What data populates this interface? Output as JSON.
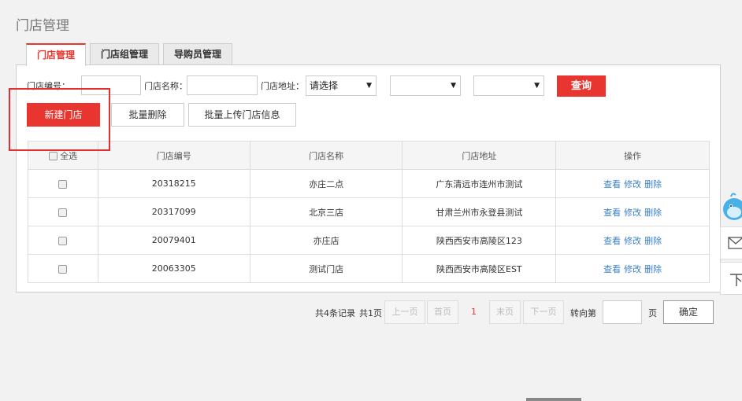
{
  "page": {
    "title": "门店管理"
  },
  "tabs": [
    {
      "label": "门店管理",
      "active": true
    },
    {
      "label": "门店组管理",
      "active": false
    },
    {
      "label": "导购员管理",
      "active": false
    }
  ],
  "filters": {
    "store_code_label": "门店编号：",
    "store_name_label": "门店名称：",
    "store_address_label": "门店地址：",
    "province_select": "请选择",
    "city_select": "",
    "district_select": "",
    "query_button": "查询"
  },
  "actions": {
    "new_store": "新建门店",
    "batch_delete": "批量删除",
    "batch_upload": "批量上传门店信息"
  },
  "table": {
    "columns": [
      "全选",
      "门店编号",
      "门店名称",
      "门店地址",
      "操作"
    ],
    "rows": [
      {
        "code": "20318215",
        "name": "亦庄二点",
        "address": "广东清远市连州市测试"
      },
      {
        "code": "20317099",
        "name": "北京三店",
        "address": "甘肃兰州市永登县测试"
      },
      {
        "code": "20079401",
        "name": "亦庄店",
        "address": "陕西西安市高陵区123"
      },
      {
        "code": "20063305",
        "name": "测试门店",
        "address": "陕西西安市高陵区EST"
      }
    ],
    "ops": {
      "view": "查看",
      "edit": "修改",
      "delete": "删除"
    }
  },
  "pager": {
    "total": "共4条记录",
    "pages": "共1页",
    "prev": "上一页",
    "first": "首页",
    "current": "1",
    "last": "末页",
    "next": "下一页",
    "goto": "转向第",
    "page_unit": "页",
    "confirm": "确定"
  },
  "colors": {
    "accent": "#e8352f",
    "link": "#3a7fc8"
  },
  "side_icons": [
    "mascot-icon",
    "mail-icon",
    "top-icon"
  ]
}
